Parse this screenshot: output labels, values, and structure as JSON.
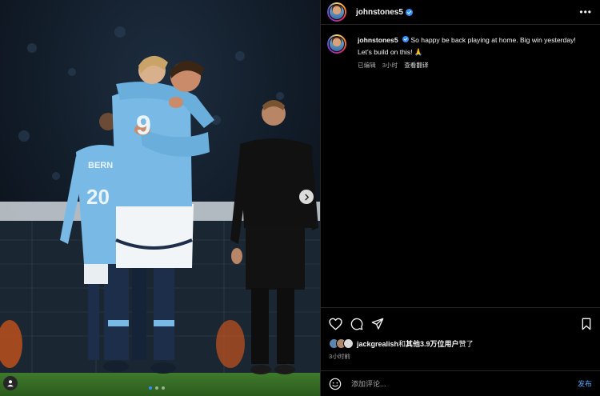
{
  "post": {
    "username": "johnstones5",
    "more_label": "•••",
    "caption": {
      "username": "johnstones5",
      "text": "So happy be back playing at home. Big win yesterday! Let's build on this! 🙏"
    },
    "meta": {
      "edited": "已编辑",
      "time": "3小时",
      "translate": "查看翻译"
    },
    "likes": {
      "first_liker": "jackgrealish",
      "connector": "和",
      "others": "其他3.9万位用户",
      "suffix": "赞了"
    },
    "timestamp": "3小时前",
    "comment": {
      "placeholder": "添加评论...",
      "post_label": "发布"
    }
  },
  "photo": {
    "jersey_number": "9",
    "back_player_number": "20",
    "back_player_name": "BERN",
    "carousel": {
      "total": 3,
      "active": 1
    }
  },
  "colors": {
    "sky_blue": "#78b9e6",
    "link_blue": "#4ca6ff",
    "verified_blue": "#2f8fff"
  },
  "icons": {
    "like": "heart-icon",
    "comment": "comment-icon",
    "share": "paper-plane-icon",
    "save": "bookmark-icon",
    "emoji": "smiley-icon",
    "next": "chevron-right-icon",
    "tag": "user-tag-icon"
  }
}
